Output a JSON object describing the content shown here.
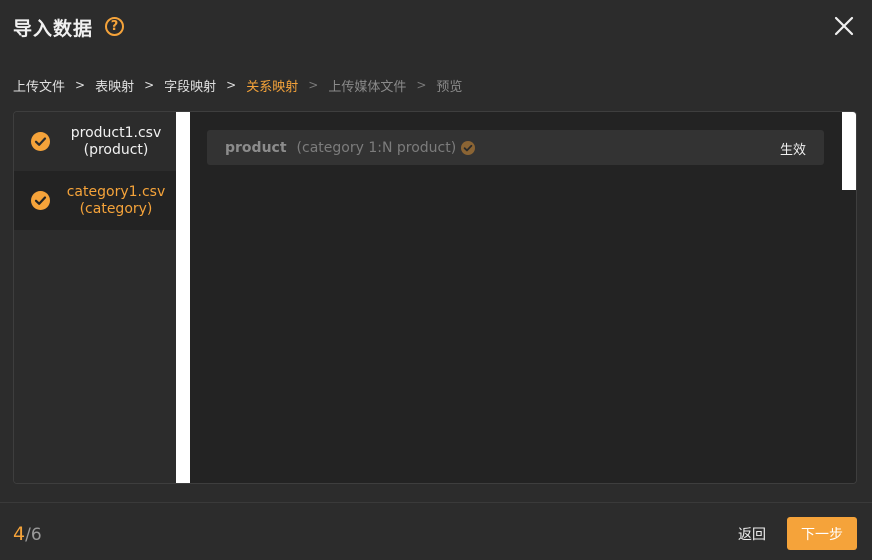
{
  "dialog": {
    "title": "导入数据",
    "help_icon": "question-circle-icon",
    "help_glyph": "?",
    "close_icon": "close-icon"
  },
  "breadcrumb": {
    "items": [
      {
        "label": "上传文件",
        "state": "done"
      },
      {
        "label": "表映射",
        "state": "done"
      },
      {
        "label": "字段映射",
        "state": "done"
      },
      {
        "label": "关系映射",
        "state": "active"
      },
      {
        "label": "上传媒体文件",
        "state": "pending"
      },
      {
        "label": "预览",
        "state": "pending"
      }
    ],
    "separator": ">"
  },
  "files": [
    {
      "name": "product1.csv",
      "table": "(product)",
      "checked": true,
      "selected": false
    },
    {
      "name": "category1.csv",
      "table": "(category)",
      "checked": true,
      "selected": true
    }
  ],
  "relations": [
    {
      "source": "product",
      "description": "(category 1:N product)",
      "status": "生效",
      "check_icon": "check-circle-icon"
    }
  ],
  "footer": {
    "step_current": "4",
    "step_total": "/6",
    "back_label": "返回",
    "next_label": "下一步"
  },
  "colors": {
    "accent": "#f5a33a",
    "background": "#2c2c2c",
    "panel": "#232323"
  }
}
